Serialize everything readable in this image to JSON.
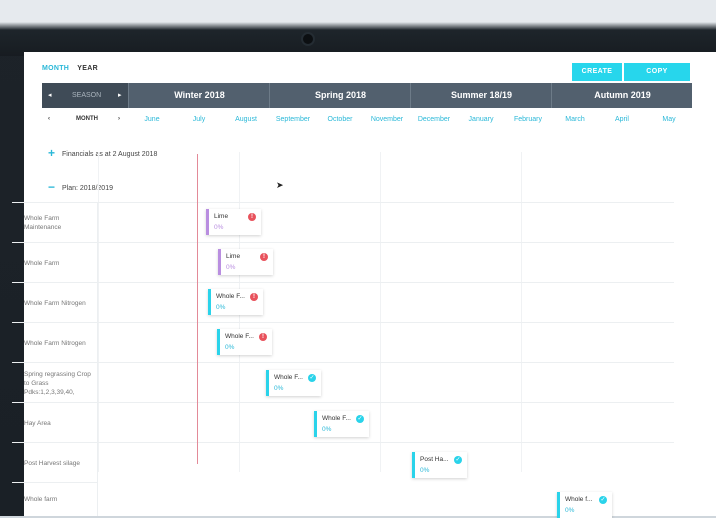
{
  "tabs": {
    "month": "MONTH",
    "year": "YEAR"
  },
  "actions": {
    "create": "CREATE",
    "copy": "COPY"
  },
  "season_nav": {
    "label": "SEASON",
    "prev": "◂",
    "next": "▸"
  },
  "seasons": [
    "Winter 2018",
    "Spring 2018",
    "Summer 18/19",
    "Autumn 2019"
  ],
  "month_nav": {
    "label": "MONTH",
    "prev": "‹",
    "next": "›"
  },
  "months": [
    "June",
    "July",
    "August",
    "September",
    "October",
    "November",
    "December",
    "January",
    "February",
    "March",
    "April",
    "May"
  ],
  "sections": [
    {
      "symbol": "+",
      "label": "Financials as at 2 August 2018"
    },
    {
      "symbol": "−",
      "label": "Plan: 2018/2019"
    }
  ],
  "rows": [
    {
      "label": "Whole Farm Maintenance"
    },
    {
      "label": "Whole Farm"
    },
    {
      "label": "Whole Farm Nitrogen"
    },
    {
      "label": "Whole Farm Nitrogen"
    },
    {
      "label": "Spring regrassing Crop to Grass Pdks:1,2,3,39,40,"
    },
    {
      "label": "Hay Area"
    },
    {
      "label": "Post Harvest silage"
    },
    {
      "label": "Whole farm"
    }
  ],
  "cards": [
    {
      "title": "Lime",
      "pct": "0%",
      "status": "error",
      "color": "purple"
    },
    {
      "title": "Lime",
      "pct": "0%",
      "status": "error",
      "color": "purple"
    },
    {
      "title": "Whole F...",
      "pct": "0%",
      "status": "error",
      "color": "cyan"
    },
    {
      "title": "Whole F...",
      "pct": "0%",
      "status": "error",
      "color": "cyan"
    },
    {
      "title": "Whole F...",
      "pct": "0%",
      "status": "ok",
      "color": "cyan"
    },
    {
      "title": "Whole F...",
      "pct": "0%",
      "status": "ok",
      "color": "cyan"
    },
    {
      "title": "Post Ha...",
      "pct": "0%",
      "status": "ok",
      "color": "cyan"
    },
    {
      "title": "Whole f...",
      "pct": "0%",
      "status": "ok",
      "color": "cyan"
    }
  ],
  "icons": {
    "error": "!",
    "ok": "✓"
  },
  "colors": {
    "accent": "#27d6ec",
    "season_bar": "#52606e",
    "error": "#e8525c",
    "today_line": "#e38a98",
    "lime": "#b98ee0"
  }
}
